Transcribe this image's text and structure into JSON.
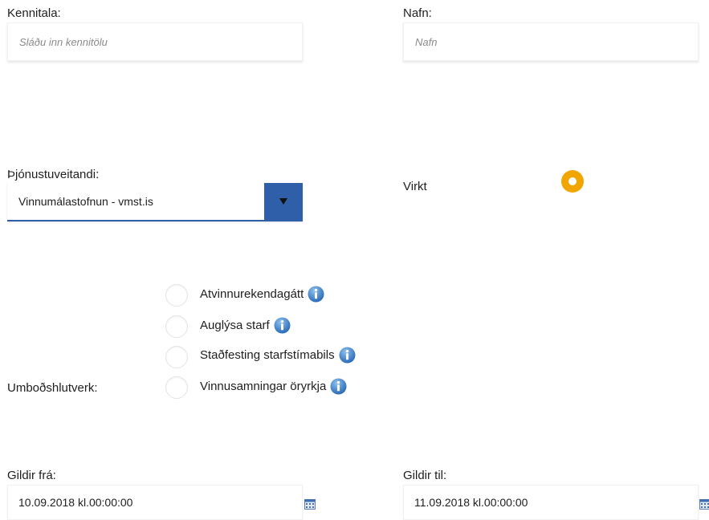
{
  "kennitala": {
    "label": "Kennitala:",
    "placeholder": "Sláðu inn kennitölu"
  },
  "nafn": {
    "label": "Nafn:",
    "placeholder": "Nafn"
  },
  "provider": {
    "label": "Þjónustuveitandi:",
    "selected": "Vinnumálastofnun - vmst.is"
  },
  "active": {
    "label": "Virkt",
    "checked": true,
    "accent": "#f0a500"
  },
  "roles": {
    "label": "Umboðshlutverk:",
    "options": [
      {
        "label": "Atvinnurekendagátt",
        "checked": false
      },
      {
        "label": "Auglýsa starf",
        "checked": false
      },
      {
        "label": "Staðfesting starfstímabils",
        "checked": false
      },
      {
        "label": "Vinnusamningar öryrkja",
        "checked": false
      }
    ]
  },
  "valid_from": {
    "label": "Gildir frá:",
    "value": "10.09.2018 kl.00:00:00"
  },
  "valid_to": {
    "label": "Gildir til:",
    "value": "11.09.2018 kl.00:00:00"
  },
  "colors": {
    "accent_blue": "#2e5fa8",
    "toggle_orange": "#f0a500"
  }
}
